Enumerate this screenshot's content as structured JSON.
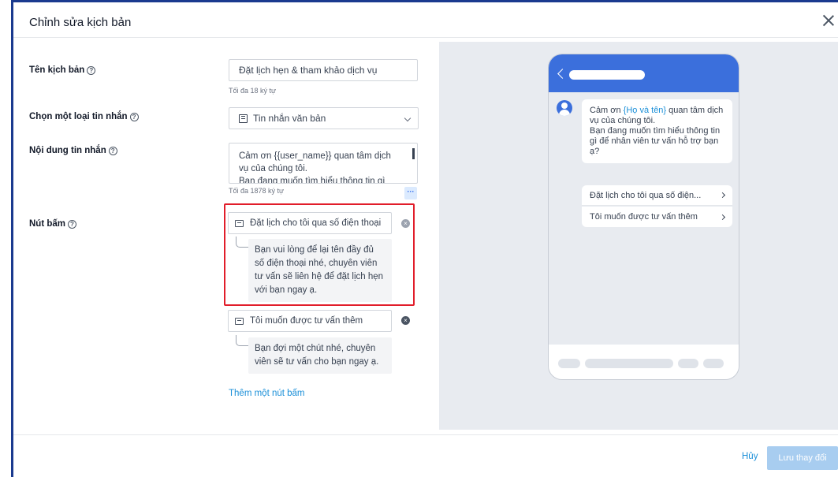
{
  "dialog": {
    "title": "Chỉnh sửa kịch bản"
  },
  "form": {
    "scenario_name": {
      "label": "Tên kịch bản",
      "value": "Đặt lịch hẹn & tham khảo dịch vụ",
      "hint": "Tối đa 18 ký tự"
    },
    "message_type": {
      "label": "Chọn một loại tin nhắn",
      "value": "Tin nhắn văn bản"
    },
    "message_content": {
      "label": "Nội dung tin nhắn",
      "line1": "Cảm ơn {{user_name}} quan tâm dịch",
      "line2": "vụ của chúng tôi.",
      "line3": "Bạn đang muốn tìm hiểu thông tin gì",
      "hint": "Tối đa 1878 ký tự",
      "more_label": "···"
    },
    "buttons": {
      "label": "Nút bấm",
      "items": [
        {
          "label": "Đặt lịch cho tôi qua số điện thoại",
          "reply": "Bạn vui lòng để lại tên đầy đủ số điện thoại nhé, chuyên viên tư vấn sẽ liên hệ để đặt lịch hẹn với bạn ngay ạ."
        },
        {
          "label": "Tôi muốn được tư vấn thêm",
          "reply": "Bạn đợi một chút nhé, chuyên viên sẽ tư vấn cho bạn ngay ạ."
        }
      ],
      "add_label": "Thêm một nút bấm"
    }
  },
  "preview": {
    "greeting_before": "Cảm ơn ",
    "greeting_var": "{Họ và tên}",
    "greeting_after": " quan tâm dịch vụ của chúng tôi.",
    "greeting_line2": "Bạn đang muốn tìm hiểu thông tin gì để nhân viên tư vấn hỗ trợ bạn ạ?",
    "button1": "Đặt lịch cho tôi qua số điện...",
    "button2": "Tôi muốn được tư vấn thêm"
  },
  "footer": {
    "cancel_label": "Hủy",
    "save_label": "Lưu thay đổi"
  },
  "colors": {
    "accent": "#3b6fdc",
    "link": "#1a8fd8",
    "highlight": "#e11d2a",
    "save_disabled": "#a8cdf0"
  },
  "icons": {
    "help": "question-circle-icon",
    "close": "close-icon",
    "message_type": "message-template-icon",
    "chevron": "chevron-down-icon",
    "button_item": "message-icon",
    "remove": "remove-circle-icon",
    "back": "chevron-left-icon",
    "avatar": "user-avatar-icon"
  }
}
